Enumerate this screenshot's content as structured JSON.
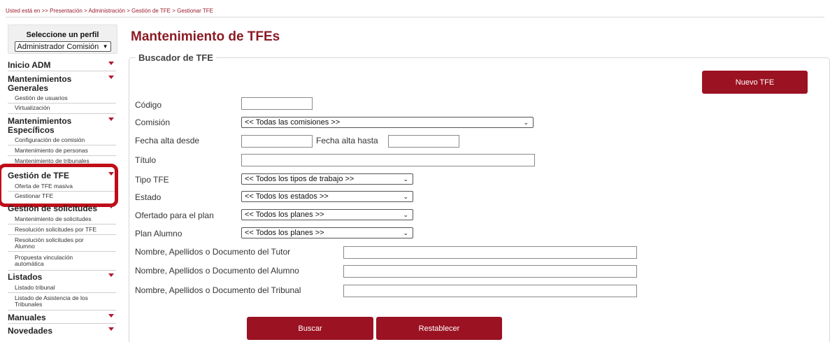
{
  "breadcrumb": "Usted está en >> Presentación > Administración > Gestión de TFE > Gestionar TFE",
  "sidebar": {
    "profile_title": "Seleccione un perfil",
    "profile_selected": "Administrador Comisión",
    "sections": {
      "inicio": "Inicio ADM",
      "mant_generales_1": "Mantenimientos",
      "mant_generales_2": "Generales",
      "gestion_usuarios": "Gestión de usuarios",
      "virtualizacion": "Virtualización",
      "mant_especificos_1": "Mantenimientos",
      "mant_especificos_2": "Específicos",
      "config_comision": "Configuración de comisión",
      "mant_personas": "Mantenimiento de personas",
      "mant_tribunales": "Mantenimiento de tribunales",
      "gestion_tfe": "Gestión de TFE",
      "oferta_masiva": "Oferta de TFE masiva",
      "gestionar_tfe": "Gestionar TFE",
      "gestion_solicitudes": "Gestión de solicitudes",
      "mant_solicitudes": "Mantenimiento de solicitudes",
      "resol_tfe": "Resolución solicitudes por TFE",
      "resol_alumno_1": "Resolución solicitudes por",
      "resol_alumno_2": "Alumno",
      "propuesta_1": "Propuesta vinculación",
      "propuesta_2": "automática",
      "listados": "Listados",
      "listado_tribunal": "Listado tribunal",
      "asistencia_1": "Listado de Asistencia de los",
      "asistencia_2": "Tribunales",
      "manuales": "Manuales",
      "novedades": "Novedades"
    }
  },
  "main": {
    "title": "Mantenimiento de TFEs",
    "legend": "Buscador de TFE",
    "new_button": "Nuevo TFE",
    "labels": {
      "codigo": "Código",
      "comision": "Comisión",
      "fecha_desde": "Fecha alta desde",
      "fecha_hasta": "Fecha alta hasta",
      "titulo": "Título",
      "tipo": "Tipo TFE",
      "estado": "Estado",
      "ofertado": "Ofertado para el plan",
      "plan_alumno": "Plan Alumno",
      "tutor": "Nombre, Apellidos o Documento del Tutor",
      "alumno": "Nombre, Apellidos o Documento del Alumno",
      "tribunal": "Nombre, Apellidos o Documento del Tribunal"
    },
    "selects": {
      "comision": "<< Todas las comisiones >>",
      "tipo": "<< Todos los tipos de trabajo >>",
      "estado": "<< Todos los estados >>",
      "ofertado": "<< Todos los planes >>",
      "plan_alumno": "<< Todos los planes >>"
    },
    "search_button": "Buscar",
    "reset_button": "Restablecer"
  },
  "icons": {
    "dropdown": "chevron-down-icon",
    "menu_arrow": "caret-down-icon"
  },
  "colors": {
    "brand": "#9b1222",
    "title": "#8b1a24",
    "highlight": "#c00d18"
  }
}
